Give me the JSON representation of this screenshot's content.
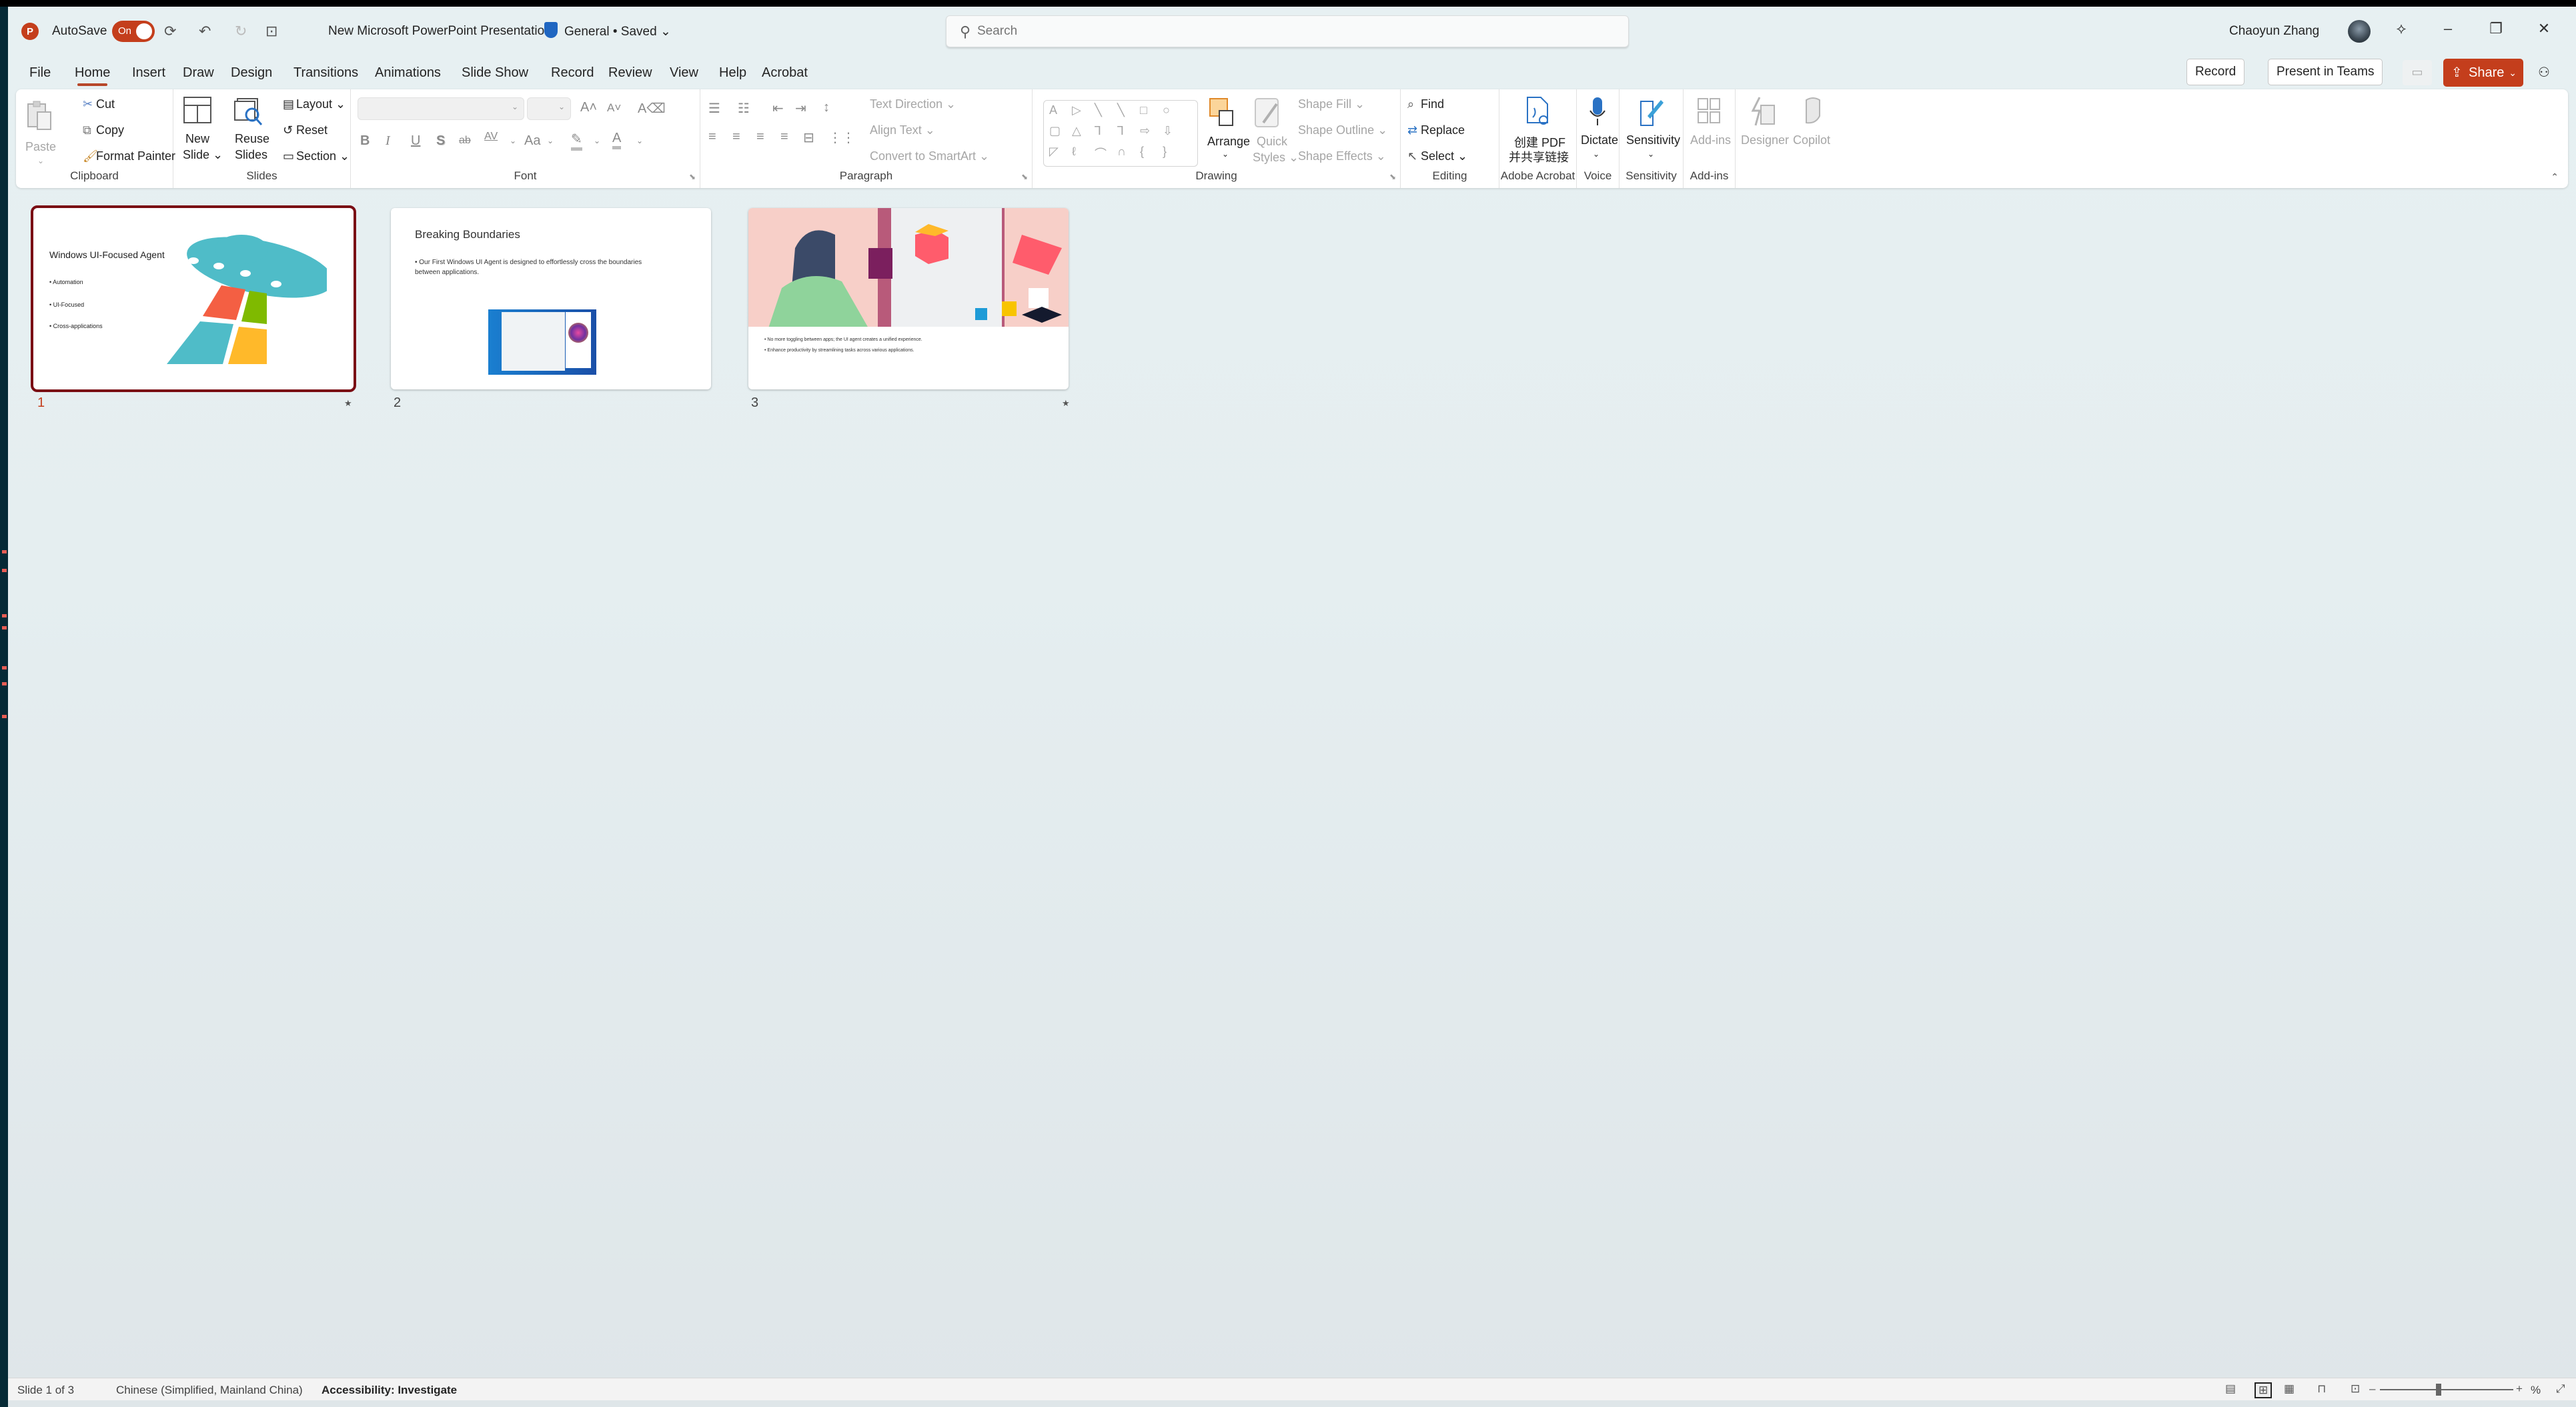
{
  "titlebar": {
    "app_icon": "powerpoint-logo",
    "app_letter": "P",
    "autosave_label": "AutoSave",
    "autosave_state": "On",
    "quick_access": [
      {
        "name": "save-sync-icon",
        "glyph": "⟳"
      },
      {
        "name": "undo-icon",
        "glyph": "↶"
      },
      {
        "name": "redo-icon",
        "glyph": "↻"
      },
      {
        "name": "present-from-beginning-icon",
        "glyph": "⊡"
      }
    ],
    "document_title": "New Microsoft PowerPoint Presentation",
    "sensitivity_status": "General • Saved",
    "status_chevron": "⌄",
    "search_placeholder": "Search",
    "user_name": "Chaoyun Zhang",
    "window_buttons": {
      "premium": "⟡",
      "minimize": "–",
      "restore": "❐",
      "close": "✕"
    }
  },
  "tabs": [
    {
      "label": "File"
    },
    {
      "label": "Home",
      "active": true
    },
    {
      "label": "Insert"
    },
    {
      "label": "Draw"
    },
    {
      "label": "Design"
    },
    {
      "label": "Transitions"
    },
    {
      "label": "Animations"
    },
    {
      "label": "Slide Show"
    },
    {
      "label": "Record"
    },
    {
      "label": "Review"
    },
    {
      "label": "View"
    },
    {
      "label": "Help"
    },
    {
      "label": "Acrobat"
    }
  ],
  "tab_actions": {
    "record": "Record",
    "present_in_teams": "Present in Teams",
    "share": "Share",
    "share_chevron": "⌄",
    "comment_glyph": "▭",
    "collab_glyph": "⚇"
  },
  "ribbon": {
    "clipboard": {
      "label": "Clipboard",
      "paste": "Paste",
      "cut": "Cut",
      "copy": "Copy",
      "format_painter": "Format Painter"
    },
    "slides": {
      "label": "Slides",
      "new_slide_line1": "New",
      "new_slide_line2": "Slide ⌄",
      "reuse_line1": "Reuse",
      "reuse_line2": "Slides",
      "layout": "Layout ⌄",
      "reset": "Reset",
      "section": "Section ⌄"
    },
    "font": {
      "label": "Font",
      "font_name": "",
      "font_size": "",
      "buttons": [
        "A˄",
        "A˅",
        "A⌫",
        "B",
        "I",
        "U",
        "S",
        "ab",
        "AV",
        "Aa",
        "✎",
        "A"
      ]
    },
    "paragraph": {
      "label": "Paragraph",
      "text_direction": "Text Direction ⌄",
      "align_text": "Align Text ⌄",
      "convert_smartart": "Convert to SmartArt ⌄"
    },
    "drawing": {
      "label": "Drawing",
      "shapes": [
        "A",
        "▷",
        "╲",
        "╲",
        "□",
        "○",
        "▢",
        "△",
        "⅂",
        "⅂",
        "⇨",
        "⇩",
        "◸",
        "ℓ",
        "⌒",
        "∩",
        "{",
        "}"
      ],
      "arrange": "Arrange",
      "quick_styles_line1": "Quick",
      "quick_styles_line2": "Styles ⌄",
      "shape_fill": "Shape Fill ⌄",
      "shape_outline": "Shape Outline ⌄",
      "shape_effects": "Shape Effects ⌄"
    },
    "editing": {
      "label": "Editing",
      "find": "Find",
      "replace": "Replace",
      "select": "Select ⌄"
    },
    "adobe": {
      "label": "Adobe Acrobat",
      "create_line1": "创建 PDF",
      "create_line2": "并共享链接"
    },
    "voice": {
      "label": "Voice",
      "dictate": "Dictate"
    },
    "sensitivity": {
      "label": "Sensitivity",
      "button": "Sensitivity"
    },
    "addins": {
      "label": "Add-ins",
      "button": "Add-ins"
    },
    "designer": "Designer",
    "copilot": "Copilot"
  },
  "slides": [
    {
      "number": "1",
      "selected": true,
      "title": "Windows UI-Focused Agent",
      "bullets": [
        "Automation",
        "UI-Focused",
        "Cross-applications"
      ],
      "has_transition_icon": true
    },
    {
      "number": "2",
      "selected": false,
      "title": "Breaking Boundaries",
      "bullets": [
        "Our First Windows UI Agent is designed to effortlessly cross the boundaries between applications."
      ],
      "has_transition_icon": false
    },
    {
      "number": "3",
      "selected": false,
      "title": "",
      "bullets": [
        "No more toggling between apps; the UI agent creates a unified experience.",
        "Enhance productivity by streamlining tasks across various applications."
      ],
      "has_transition_icon": true
    }
  ],
  "statusbar": {
    "slide_position": "Slide 1 of 3",
    "language": "Chinese (Simplified, Mainland China)",
    "accessibility": "Accessibility: Investigate",
    "zoom_suffix": "%"
  },
  "colors": {
    "accent": "#c43e1c",
    "selected_slide_border": "#7a0d14",
    "ufo_teal": "#4fbcc8",
    "win_red": "#f45f43",
    "win_green": "#7fba00",
    "win_yellow": "#ffb92a"
  }
}
